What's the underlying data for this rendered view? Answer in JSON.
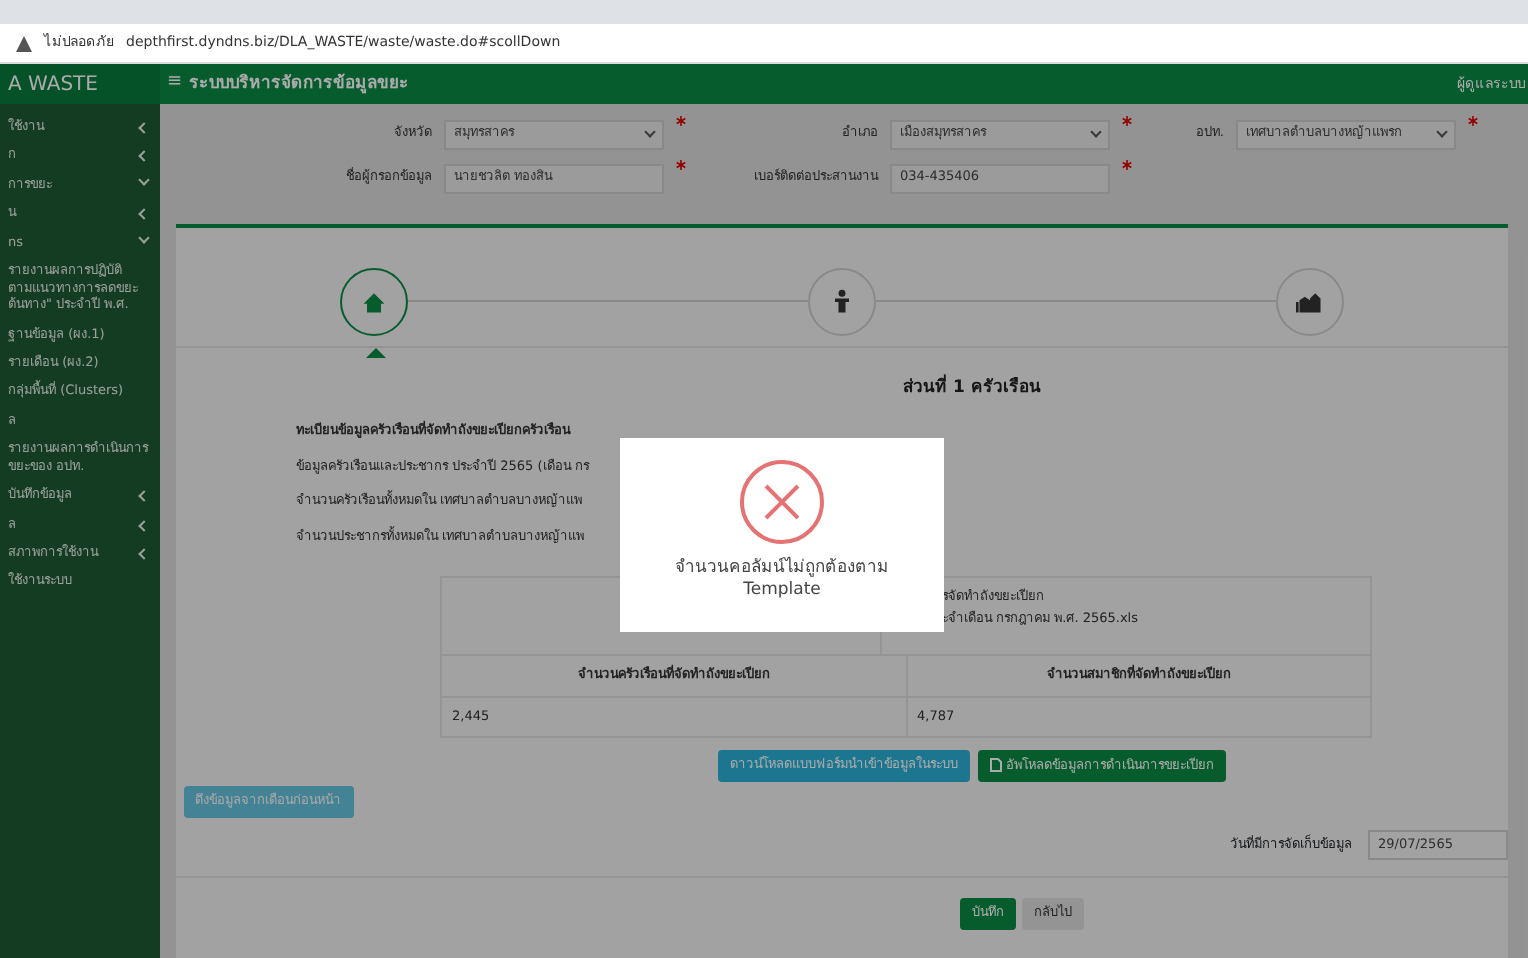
{
  "browser": {
    "security": "ไม่ปลอดภัย",
    "url": "depthfirst.dyndns.biz/DLA_WASTE/waste/waste.do#scollDown"
  },
  "header": {
    "brand": "A WASTE",
    "menu_glyph": "≡",
    "title": "ระบบบริหารจัดการข้อมูลขยะ",
    "user": "ผู้ดูแลระบบ"
  },
  "sidebar": {
    "items": [
      {
        "label": "ใช้งาน",
        "kind": "group",
        "expanded": false
      },
      {
        "label": "ก",
        "kind": "group",
        "expanded": false
      },
      {
        "label": "การขยะ",
        "kind": "group",
        "expanded": true
      },
      {
        "label": "น",
        "kind": "group",
        "expanded": false
      },
      {
        "label": "ns",
        "kind": "group",
        "expanded": true
      },
      {
        "label": "รายงานผลการปฏิบัติ ตามแนวทางการลดขยะ ต้นทาง\" ประจำปี พ.ศ.",
        "kind": "link"
      },
      {
        "label": "ฐานข้อมูล (ผง.1)",
        "kind": "link"
      },
      {
        "label": "รายเดือน (ผง.2)",
        "kind": "link"
      },
      {
        "label": "กลุ่มพื้นที่ (Clusters)",
        "kind": "link"
      },
      {
        "label": "ล",
        "kind": "link"
      },
      {
        "label": "รายงานผลการดำเนินการ ขยะของ อปท.",
        "kind": "link"
      },
      {
        "label": "บันทึกข้อมูล",
        "kind": "group",
        "expanded": false
      },
      {
        "label": "ล",
        "kind": "group",
        "expanded": false
      },
      {
        "label": "สภาพการใช้งาน",
        "kind": "group",
        "expanded": false
      },
      {
        "label": "ใช้งานระบบ",
        "kind": "link"
      }
    ]
  },
  "filters": [
    {
      "label": "จังหวัด",
      "value": "สมุทรสาคร",
      "kind": "select",
      "required": true
    },
    {
      "label": "อำเภอ",
      "value": "เมืองสมุทรสาคร",
      "kind": "select",
      "required": true
    },
    {
      "label": "อปท.",
      "value": "เทศบาลตำบลบางหญ้าแพรก",
      "kind": "select",
      "required": true
    },
    {
      "label": "ชื่อผู้กรอกข้อมูล",
      "value": "นายชวลิต ทองสิน",
      "kind": "input",
      "required": true
    },
    {
      "label": "เบอร์ติดต่อประสานงาน",
      "value": "034-435406",
      "kind": "input",
      "required": true
    }
  ],
  "steps": [
    {
      "selected": true
    },
    {
      "selected": false
    },
    {
      "selected": false
    }
  ],
  "section_title": "ส่วนที่ 1 ครัวเรือน",
  "info": {
    "heading": "ทะเบียนข้อมูลครัวเรือนที่จัดทำถังขยะเปียกครัวเรือน",
    "lines": [
      "ข้อมูลครัวเรือนและประชากร ประจำปี 2565 (เดือน กร",
      "จำนวนครัวเรือนทั้งหมดใน เทศบาลตำบลบางหญ้าแพ",
      "จำนวนประชากรทั้งหมดใน เทศบาลตำบลบางหญ้าแพ"
    ]
  },
  "table": {
    "file_label": "รจัดทำถังขยะเปียก",
    "file_name": "ะจำเดือน กรกฎาคม พ.ศ. 2565.xls",
    "columns": [
      "จำนวนครัวเรือนที่จัดทำถังขยะเปียก",
      "จำนวนสมาชิกที่จัดทำถังขยะเปียก"
    ],
    "rows": [
      [
        "2,445",
        "4,787"
      ]
    ]
  },
  "buttons": {
    "download": "ดาวน์โหลดแบบฟอร์มนำเข้าข้อมูลในระบบ",
    "upload": "อัพโหลดข้อมูลการดำเนินการขยะเปียก",
    "pull": "ดึงข้อมูลจากเดือนก่อนหน้า",
    "save": "บันทึก",
    "back": "กลับไป"
  },
  "collect_date": {
    "label": "วันที่มีการจัดเก็บข้อมูล",
    "value": "29/07/2565"
  },
  "modal": {
    "kind": "error",
    "message": "จำนวนคอลัมน์ไม่ถูกต้องตาม Template"
  }
}
